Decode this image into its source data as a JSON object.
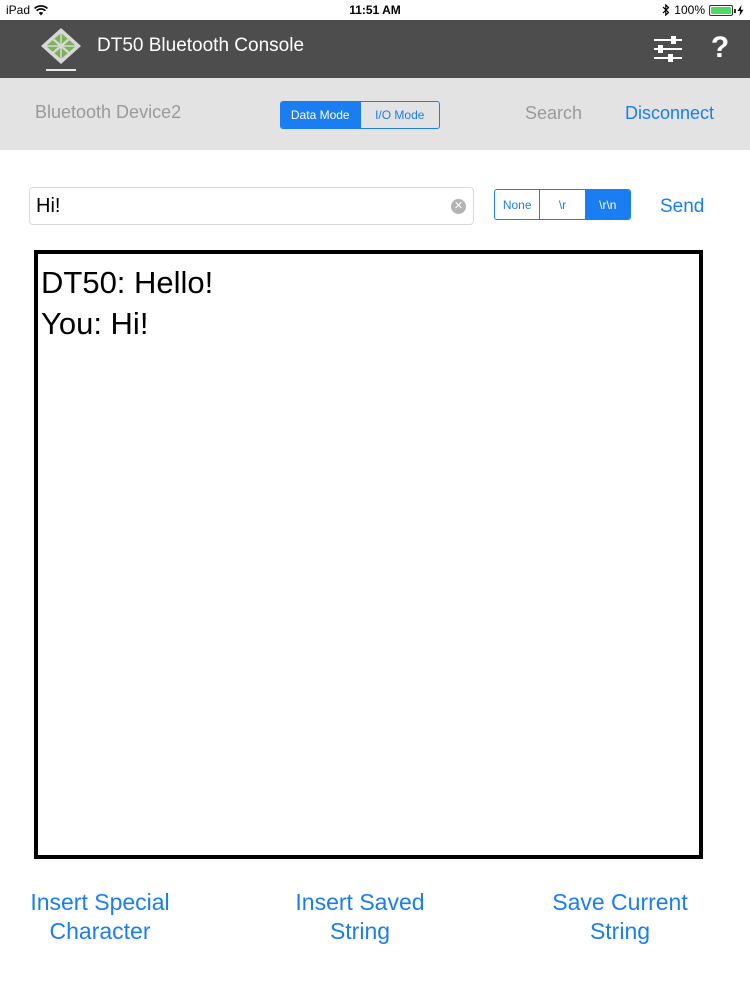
{
  "status_bar": {
    "device": "iPad",
    "time": "11:51 AM",
    "battery_text": "100%",
    "battery_level": 1.0
  },
  "header": {
    "title": "DT50 Bluetooth Console",
    "icons": [
      "app-logo",
      "settings-sliders-icon",
      "help-icon"
    ],
    "help_label": "?",
    "background_color": "#4d4d4d"
  },
  "device_bar": {
    "device_name": "Bluetooth Device2",
    "modes": [
      {
        "label": "Data Mode",
        "active": true
      },
      {
        "label": "I/O Mode",
        "active": false
      }
    ],
    "search_label": "Search",
    "disconnect_label": "Disconnect"
  },
  "input_row": {
    "value": "Hi!",
    "line_endings": [
      {
        "label": "None",
        "active": false
      },
      {
        "label": "\\r",
        "active": false
      },
      {
        "label": "\\r\\n",
        "active": true
      }
    ],
    "send_label": "Send"
  },
  "console": {
    "lines": [
      "DT50: Hello!",
      "You: Hi!"
    ]
  },
  "bottom_buttons": [
    {
      "lines": [
        "Insert Special",
        "Character"
      ]
    },
    {
      "lines": [
        "Insert Saved",
        "String"
      ]
    },
    {
      "lines": [
        "Save Current",
        "String"
      ]
    }
  ],
  "colors": {
    "accent": "#1a7ef2",
    "muted_text": "#9a9a9a",
    "device_bar_bg": "#e3e3e3",
    "battery": "#4cd964"
  }
}
